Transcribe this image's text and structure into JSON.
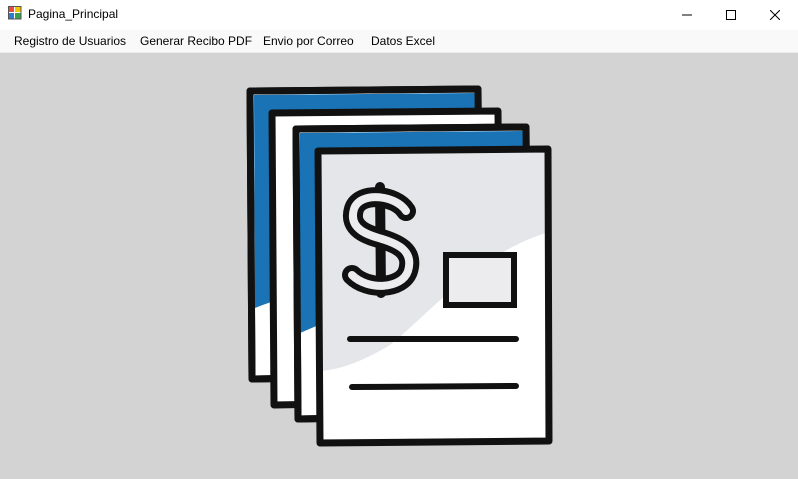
{
  "window": {
    "title": "Pagina_Principal",
    "icon": "winforms-app-icon",
    "controls": {
      "minimize": "minimize-icon",
      "maximize": "maximize-icon",
      "close": "close-icon"
    }
  },
  "menu": {
    "items": [
      {
        "label": "Registro de Usuarios"
      },
      {
        "label": "Generar Recibo PDF"
      },
      {
        "label": "Envio por Correo"
      },
      {
        "label": "Datos Excel"
      }
    ]
  },
  "main": {
    "image": "receipts-dollar-illustration",
    "background": "#d3d3d3",
    "accent": "#1a73b5"
  }
}
